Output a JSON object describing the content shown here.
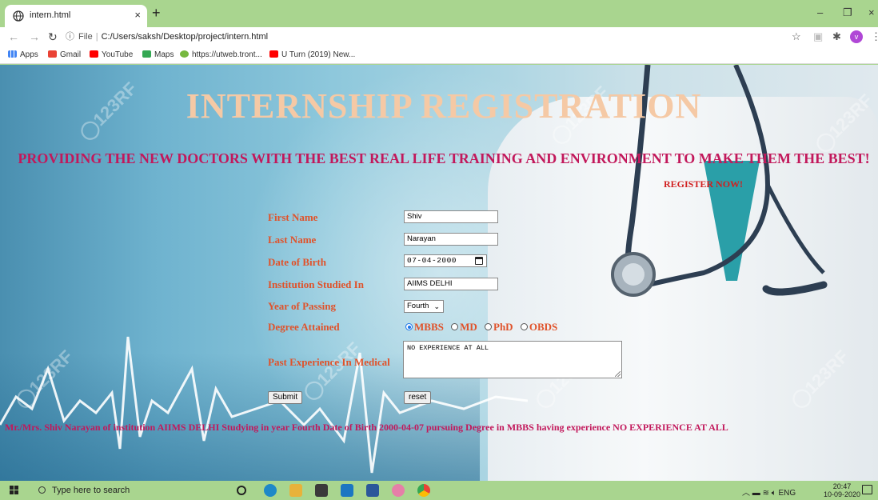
{
  "browser": {
    "tab_title": "intern.html",
    "tab_close": "×",
    "new_tab": "+",
    "window_controls": {
      "minimize": "–",
      "restore": "❐",
      "close": "×"
    },
    "address": {
      "scheme": "File",
      "path": "C:/Users/saksh/Desktop/project/intern.html"
    },
    "profile_initial": "v",
    "bookmarks": [
      {
        "label": "Apps",
        "icon": "apps-grid-icon",
        "color": "#4285f4"
      },
      {
        "label": "Gmail",
        "icon": "gmail-icon",
        "color": "#ea4335"
      },
      {
        "label": "YouTube",
        "icon": "youtube-icon",
        "color": "#ff0000"
      },
      {
        "label": "Maps",
        "icon": "maps-icon",
        "color": "#34a853"
      },
      {
        "label": "https://utweb.tront...",
        "icon": "utorrent-icon",
        "color": "#76b83f"
      },
      {
        "label": "U Turn (2019) New...",
        "icon": "youtube-icon",
        "color": "#ff0000"
      }
    ]
  },
  "page": {
    "heading": "INTERNSHIP REGISTRATION",
    "tagline": "PROVIDING THE NEW DOCTORS WITH THE BEST REAL LIFE TRAINING AND ENVIRONMENT TO MAKE THEM THE BEST!",
    "register_now": "REGISTER NOW!",
    "form": {
      "first_name_label": "First Name",
      "first_name_value": "Shiv",
      "last_name_label": "Last Name",
      "last_name_value": "Narayan",
      "dob_label": "Date of Birth",
      "dob_value": "07-04-2000",
      "institution_label": "Institution Studied In",
      "institution_value": "AIIMS DELHI",
      "year_label": "Year of Passing",
      "year_value": "Fourth",
      "degree_label": "Degree Attained",
      "degree_options": [
        "MBBS",
        "MD",
        "PhD",
        "OBDS"
      ],
      "degree_selected": "MBBS",
      "experience_label": "Past Experience In Medical",
      "experience_value": "NO EXPERIENCE AT ALL",
      "submit_label": "Submit",
      "reset_label": "reset"
    },
    "summary": "Mr./Mrs. Shiv Narayan of institution AIIMS DELHI Studying in year Fourth Date of Birth 2000-04-07 pursuing Degree in MBBS having experience NO EXPERIENCE AT ALL"
  },
  "taskbar": {
    "search_placeholder": "Type here to search",
    "tray_language": "ENG",
    "time": "20:47",
    "date": "10-09-2020"
  }
}
